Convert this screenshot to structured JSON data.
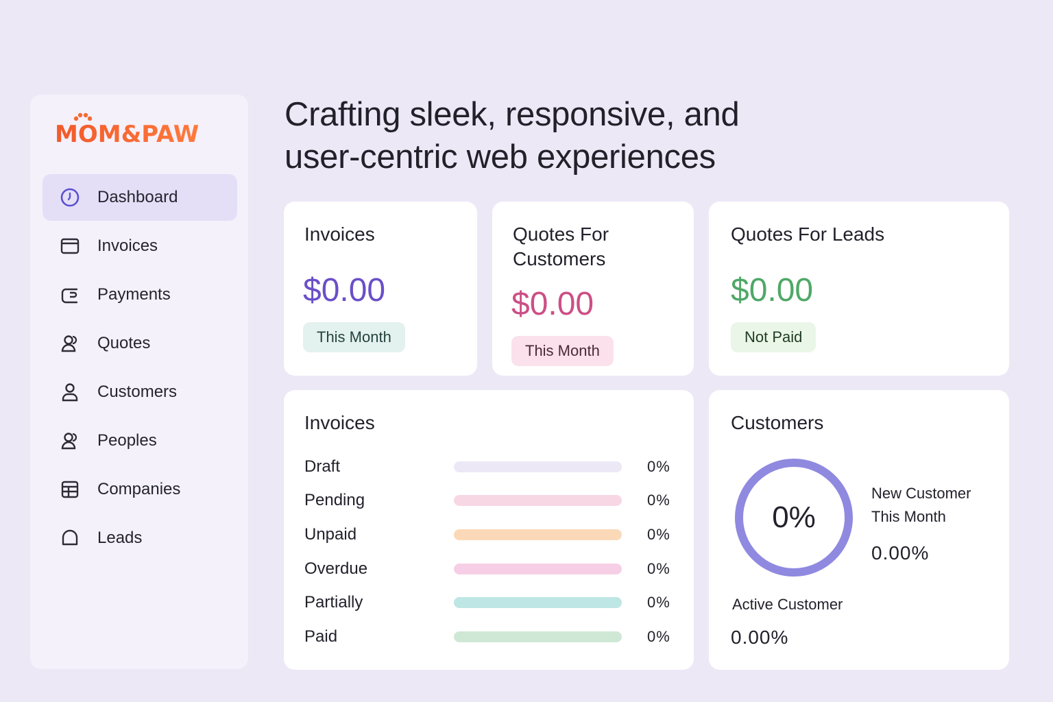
{
  "brand": {
    "logo_text": "MOM&PAW",
    "color": "#f15a2b"
  },
  "sidebar": {
    "items": [
      {
        "label": "Dashboard",
        "icon": "dashboard-icon",
        "active": true
      },
      {
        "label": "Invoices",
        "icon": "invoice-icon"
      },
      {
        "label": "Payments",
        "icon": "wallet-icon"
      },
      {
        "label": "Quotes",
        "icon": "quotes-icon"
      },
      {
        "label": "Customers",
        "icon": "user-icon"
      },
      {
        "label": "Peoples",
        "icon": "people-icon"
      },
      {
        "label": "Companies",
        "icon": "company-icon"
      },
      {
        "label": "Leads",
        "icon": "leads-icon"
      }
    ]
  },
  "headline": {
    "line1": "Crafting sleek, responsive, and",
    "line2": "user-centric web experiences"
  },
  "summary_cards": {
    "invoices": {
      "title": "Invoices",
      "amount": "$0.00",
      "badge": "This Month",
      "amount_color": "#6a4fc8"
    },
    "quotes_customers": {
      "title_line1": "Quotes For",
      "title_line2": "Customers",
      "amount": "$0.00",
      "badge": "This Month",
      "amount_color": "#cc4f86"
    },
    "quotes_leads": {
      "title": "Quotes For Leads",
      "amount": "$0.00",
      "badge": "Not Paid",
      "amount_color": "#4fa867"
    }
  },
  "invoices_breakdown": {
    "title": "Invoices",
    "rows": [
      {
        "label": "Draft",
        "percent": "0%",
        "color": "#ece8f6"
      },
      {
        "label": "Pending",
        "percent": "0%",
        "color": "#f8d7e5"
      },
      {
        "label": "Unpaid",
        "percent": "0%",
        "color": "#fbd9b8"
      },
      {
        "label": "Overdue",
        "percent": "0%",
        "color": "#f6cfe6"
      },
      {
        "label": "Partially",
        "percent": "0%",
        "color": "#bde6e4"
      },
      {
        "label": "Paid",
        "percent": "0%",
        "color": "#cfe8d6"
      }
    ]
  },
  "customers": {
    "title": "Customers",
    "ring_value": "0%",
    "ring_color": "#8f89e0",
    "new_label_line1": "New Customer",
    "new_label_line2": "This Month",
    "new_value": "0.00%",
    "active_label": "Active Customer",
    "active_value": "0.00%"
  }
}
